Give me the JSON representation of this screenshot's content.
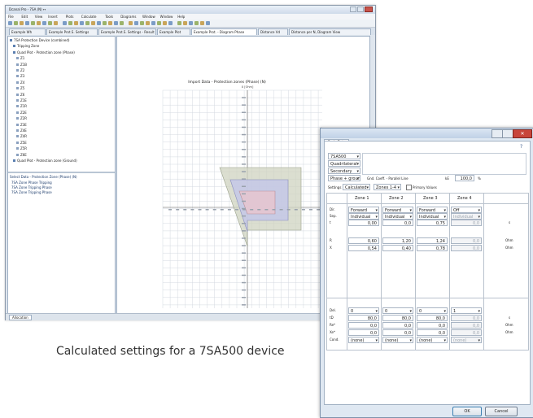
{
  "caption": "Calculated settings for a 7SA500 device",
  "main_window": {
    "title": "Dcanal Pro - 7SA (N) ↔",
    "menu": [
      "File",
      "Edit",
      "View",
      "Insert",
      "Plots",
      "Calculate",
      "Tools",
      "Diagrams",
      "Window",
      "Window",
      "Help"
    ],
    "tabs": [
      "Example Wh",
      "Example Prot.S. Settings",
      "Example Prot.S. Settings - Result Lines",
      "Example Plot",
      "Example Prot. - Diagram Phase",
      "Distance Vd",
      "Distance per N, Diagram View"
    ],
    "active_tab": 4,
    "tree_top_items": [
      "7SA Protection Device (combined)",
      "Tripping Zone",
      "Quad Plot - Protection zone (Phase)",
      "Z1",
      "Z1B",
      "Z2",
      "Z3",
      "Z4",
      "Z5",
      "Z6",
      "Z1E",
      "Z1R",
      "Z2E",
      "Z2R",
      "Z3E",
      "Z4E",
      "Z4R",
      "Z5E",
      "Z5R",
      "Z6E",
      "Quad Plot - Protection zone (Ground)"
    ],
    "tree_bottom_header": "Select Data - Protection Zone (Phase) (N)",
    "tree_bottom_items": [
      "7SA Zone Phase Tripping",
      "7SA Zone Tripping Phase",
      "7SA Zone Tripping Phase"
    ],
    "status_tab": "Allocation"
  },
  "chart": {
    "title": "Import Data - Protection zones (Phase) (N)",
    "x_axis_label": "R",
    "y_axis_label": "X [Ohm]"
  },
  "dialog": {
    "title": "",
    "tab": "Basic Data",
    "selects": [
      "7SA500",
      "Quadrilateral",
      "Secondary",
      "Phase + ground"
    ],
    "ratio_label": "Gnd. Coeff. - Parallel Line",
    "ratio_prefix": "kE",
    "ratio_value": "100,0",
    "ratio_unit": "%",
    "settings_label": "Settings",
    "settings_select": "Calculated",
    "zones_select": "Zones 1-4",
    "primary_label": "Primary Values",
    "zone_headers": [
      "Zone 1",
      "Zone 2",
      "Zone 3",
      "Zone 4"
    ],
    "row_labels": [
      "Dir.",
      "Sep.",
      "t",
      "",
      "R",
      "X",
      "",
      "Del.",
      "tD",
      "Re*",
      "Xe*",
      "Cond."
    ],
    "unit_labels": [
      "",
      "",
      "s",
      "",
      "Ohm",
      "Ohm",
      "",
      "",
      "s",
      "Ohm",
      "Ohm",
      ""
    ],
    "zones": [
      {
        "dir": "Forward",
        "sep": "Individual",
        "t": "0,00",
        "r": "0,60",
        "x": "0,54",
        "del": "0",
        "td": "80,0",
        "re": "0,0",
        "xe": "0,0",
        "cond": "(none)"
      },
      {
        "dir": "Forward",
        "sep": "Individual",
        "t": "0,0",
        "r": "1,20",
        "x": "0,40",
        "del": "0",
        "td": "80,0",
        "re": "0,0",
        "xe": "0,0",
        "cond": "(none)"
      },
      {
        "dir": "Forward",
        "sep": "Individual",
        "t": "0,75",
        "r": "1,24",
        "x": "0,78",
        "del": "0",
        "td": "80,0",
        "re": "0,0",
        "xe": "0,0",
        "cond": "(none)"
      },
      {
        "dir": "Off",
        "sep": "Individual",
        "t": "0,0",
        "r": "0,0",
        "x": "0,0",
        "del": "1",
        "td": "0,0",
        "re": "0,0",
        "xe": "0,0",
        "cond": "(none)"
      }
    ],
    "ok_label": "OK",
    "cancel_label": "Cancel"
  }
}
